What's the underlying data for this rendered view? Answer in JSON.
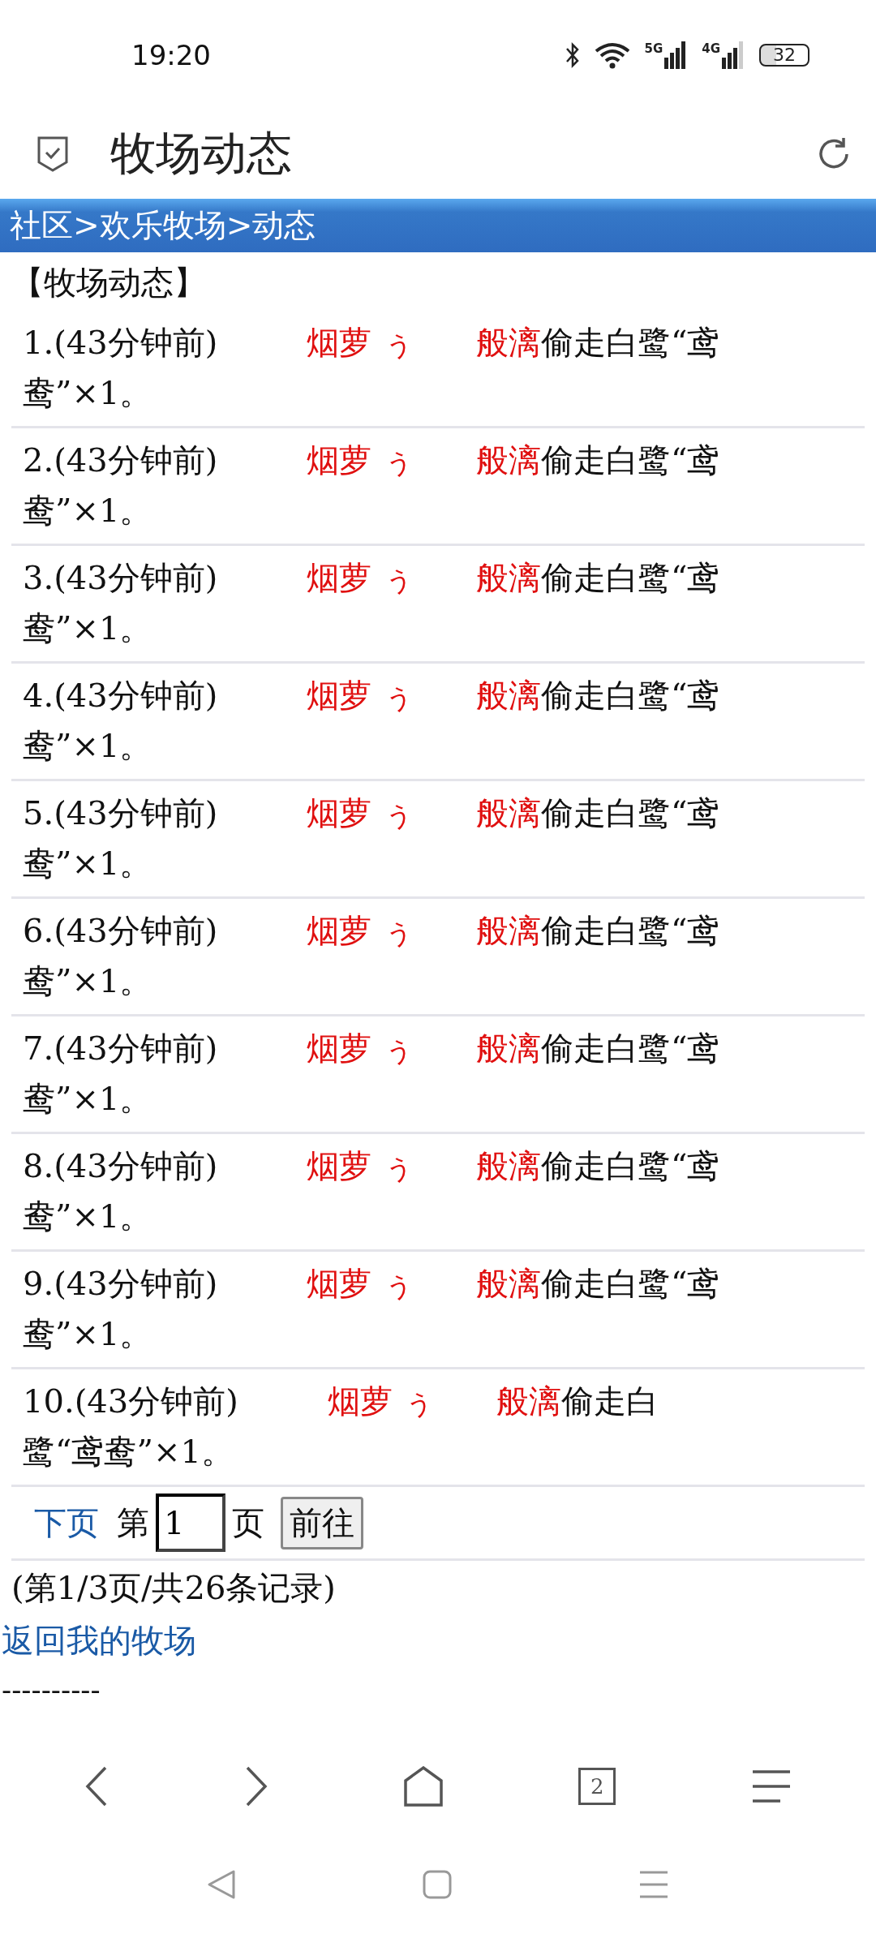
{
  "status_bar": {
    "time": "19:20",
    "networks": [
      {
        "label": "5G"
      },
      {
        "label": "4G"
      }
    ],
    "battery": "32"
  },
  "header": {
    "title": "牧场动态"
  },
  "breadcrumb": "社区>欢乐牧场>动态",
  "section_title": "【牧场动态】",
  "entries": [
    {
      "index": "1.",
      "time": "(43分钟前)",
      "actor": "烟萝 ぅ",
      "target": "般漓",
      "action": "偷走白鹭“鸢鸯”×1。"
    },
    {
      "index": "2.",
      "time": "(43分钟前)",
      "actor": "烟萝 ぅ",
      "target": "般漓",
      "action": "偷走白鹭“鸢鸯”×1。"
    },
    {
      "index": "3.",
      "time": "(43分钟前)",
      "actor": "烟萝 ぅ",
      "target": "般漓",
      "action": "偷走白鹭“鸢鸯”×1。"
    },
    {
      "index": "4.",
      "time": "(43分钟前)",
      "actor": "烟萝 ぅ",
      "target": "般漓",
      "action": "偷走白鹭“鸢鸯”×1。"
    },
    {
      "index": "5.",
      "time": "(43分钟前)",
      "actor": "烟萝 ぅ",
      "target": "般漓",
      "action": "偷走白鹭“鸢鸯”×1。"
    },
    {
      "index": "6.",
      "time": "(43分钟前)",
      "actor": "烟萝 ぅ",
      "target": "般漓",
      "action": "偷走白鹭“鸢鸯”×1。"
    },
    {
      "index": "7.",
      "time": "(43分钟前)",
      "actor": "烟萝 ぅ",
      "target": "般漓",
      "action": "偷走白鹭“鸢鸯”×1。"
    },
    {
      "index": "8.",
      "time": "(43分钟前)",
      "actor": "烟萝 ぅ",
      "target": "般漓",
      "action": "偷走白鹭“鸢鸯”×1。"
    },
    {
      "index": "9.",
      "time": "(43分钟前)",
      "actor": "烟萝 ぅ",
      "target": "般漓",
      "action": "偷走白鹭“鸢鸯”×1。"
    },
    {
      "index": "10.",
      "time": "(43分钟前)",
      "actor": "烟萝 ぅ",
      "target": "般漓",
      "action": "偷走白鹭“鸢鸯”×1。"
    }
  ],
  "pager": {
    "next_link": "下页",
    "before_input": "第",
    "page_value": "1",
    "after_input": "页",
    "go_button": "前往"
  },
  "summary": "(第1/3页/共26条记录)",
  "back_link": "返回我的牧场",
  "dashes": "----------",
  "browser_nav": {
    "tab_count": "2"
  }
}
